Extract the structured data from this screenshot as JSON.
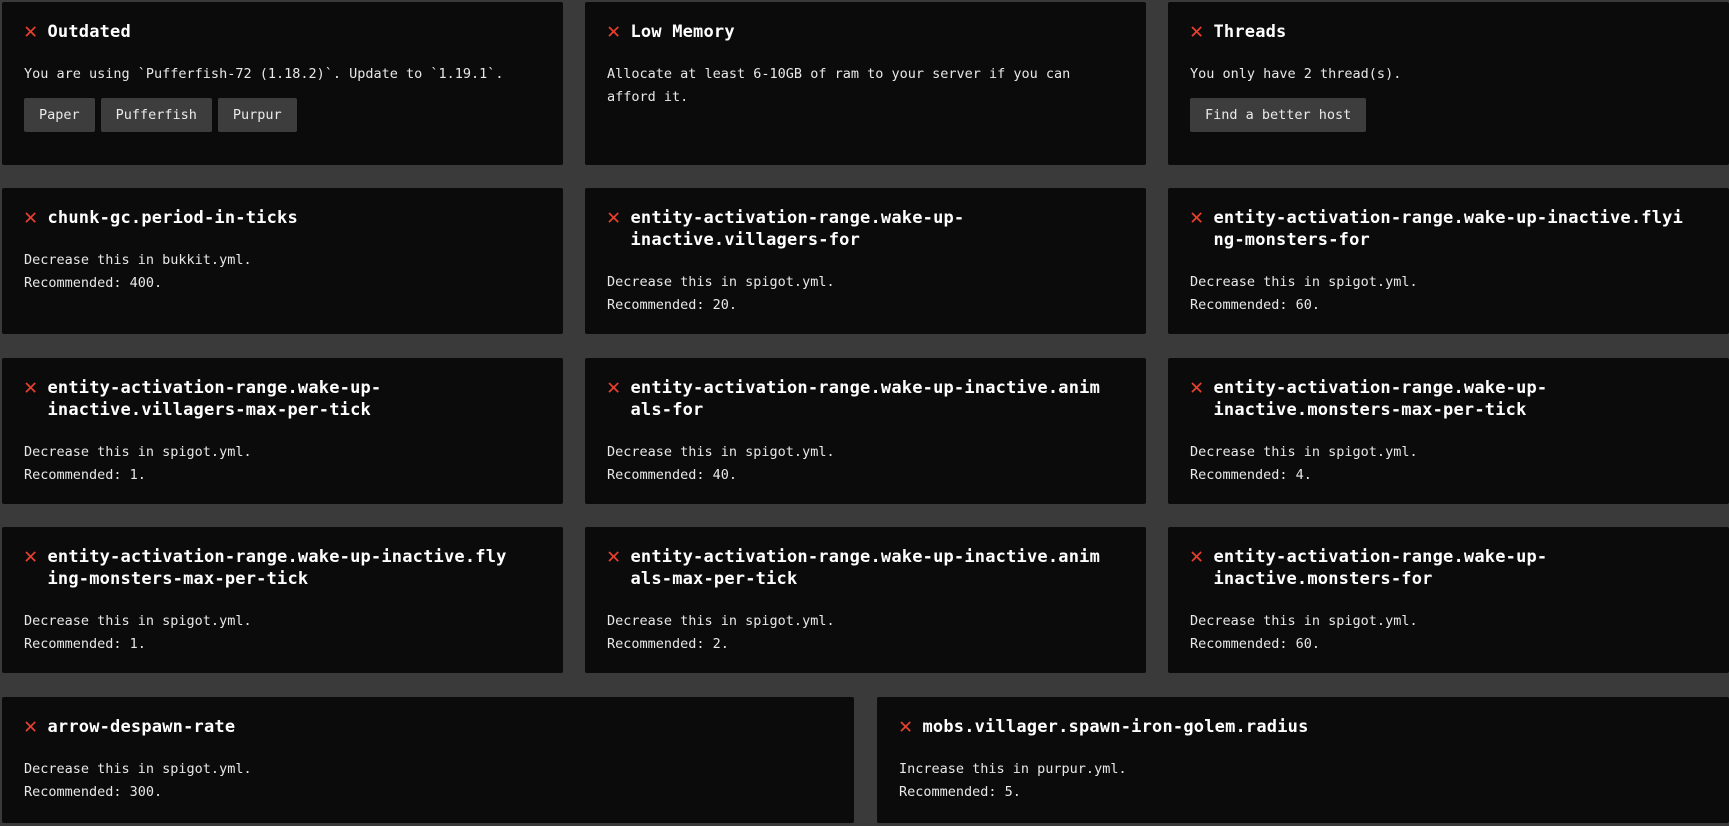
{
  "icon": "close-x-icon",
  "accent_color": "#e8402e",
  "cards_top": [
    {
      "title": "Outdated",
      "text": "You are using `Pufferfish-72 (1.18.2)`. Update to `1.19.1`.",
      "buttons": [
        "Paper",
        "Pufferfish",
        "Purpur"
      ]
    },
    {
      "title": "Low Memory",
      "text": "Allocate at least 6-10GB of ram to your server if you can afford it."
    },
    {
      "title": "Threads",
      "text": "You only have 2 thread(s).",
      "buttons": [
        "Find a better host"
      ]
    }
  ],
  "cards": [
    {
      "title": "chunk-gc.period-in-ticks",
      "line1": "Decrease this in bukkit.yml.",
      "line2": "Recommended: 400."
    },
    {
      "title": "entity-activation-range.wake-up-inactive.villagers-for",
      "line1": "Decrease this in spigot.yml.",
      "line2": "Recommended: 20."
    },
    {
      "title": "entity-activation-range.wake-up-inactive.flying-monsters-for",
      "line1": "Decrease this in spigot.yml.",
      "line2": "Recommended: 60."
    },
    {
      "title": "entity-activation-range.wake-up-inactive.villagers-max-per-tick",
      "line1": "Decrease this in spigot.yml.",
      "line2": "Recommended: 1."
    },
    {
      "title": "entity-activation-range.wake-up-inactive.animals-for",
      "line1": "Decrease this in spigot.yml.",
      "line2": "Recommended: 40."
    },
    {
      "title": "entity-activation-range.wake-up-inactive.monsters-max-per-tick",
      "line1": "Decrease this in spigot.yml.",
      "line2": "Recommended: 4."
    },
    {
      "title": "entity-activation-range.wake-up-inactive.flying-monsters-max-per-tick",
      "line1": "Decrease this in spigot.yml.",
      "line2": "Recommended: 1."
    },
    {
      "title": "entity-activation-range.wake-up-inactive.animals-max-per-tick",
      "line1": "Decrease this in spigot.yml.",
      "line2": "Recommended: 2."
    },
    {
      "title": "entity-activation-range.wake-up-inactive.monsters-for",
      "line1": "Decrease this in spigot.yml.",
      "line2": "Recommended: 60."
    },
    {
      "title": "arrow-despawn-rate",
      "line1": "Decrease this in spigot.yml.",
      "line2": "Recommended: 300."
    },
    {
      "title": "mobs.villager.spawn-iron-golem.radius",
      "line1": "Increase this in purpur.yml.",
      "line2": "Recommended: 5."
    }
  ]
}
